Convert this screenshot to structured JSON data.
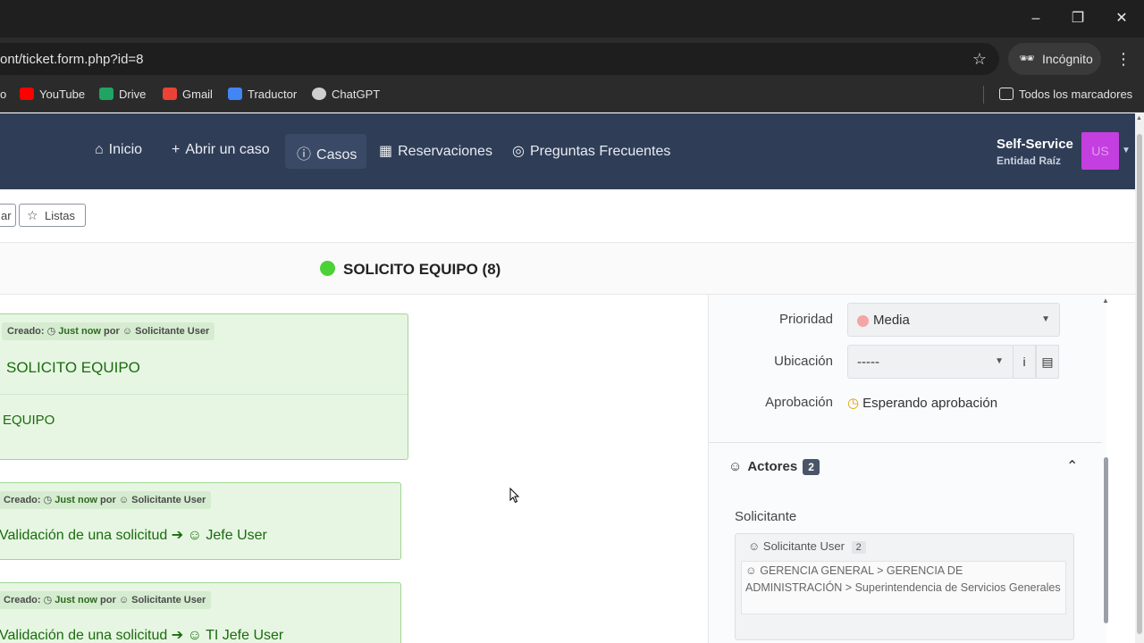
{
  "browser": {
    "url": "ont/ticket.form.php?id=8",
    "incognito_label": "Incógnito",
    "bookmarks": [
      {
        "label": "YouTube",
        "icon": "youtube-icon",
        "color": "#ff0000"
      },
      {
        "label": "Drive",
        "icon": "drive-icon",
        "color": "#1fa463"
      },
      {
        "label": "Gmail",
        "icon": "gmail-icon",
        "color": "#ea4335"
      },
      {
        "label": "Traductor",
        "icon": "translate-icon",
        "color": "#4285f4"
      },
      {
        "label": "ChatGPT",
        "icon": "chatgpt-icon",
        "color": "#cfcfcf"
      }
    ],
    "all_bookmarks_label": "Todos los marcadores"
  },
  "nav": {
    "items": [
      {
        "label": "Inicio",
        "icon": "home-icon"
      },
      {
        "label": "Abrir un caso",
        "icon": "plus-icon"
      },
      {
        "label": "Casos",
        "icon": "alert-circle-icon",
        "active": true
      },
      {
        "label": "Reservaciones",
        "icon": "calendar-icon"
      },
      {
        "label": "Preguntas Frecuentes",
        "icon": "lifebuoy-icon"
      }
    ],
    "profile_name": "Self-Service",
    "profile_entity": "Entidad Raíz",
    "avatar_initials": "US"
  },
  "toolbar": {
    "cut_label": "ar",
    "lists_label": "Listas"
  },
  "ticket": {
    "title": "SOLICITO EQUIPO (8)",
    "status_color": "#4cd137"
  },
  "timeline": [
    {
      "created_label": "Creado:",
      "time": "Just now",
      "by": "por",
      "author": "Solicitante User",
      "title": "SOLICITO EQUIPO",
      "body": "EQUIPO"
    },
    {
      "created_label": "Creado:",
      "time": "Just now",
      "by": "por",
      "author": "Solicitante User",
      "text": "Validación de una solicitud",
      "target": "Jefe User"
    },
    {
      "created_label": "Creado:",
      "time": "Just now",
      "by": "por",
      "author": "Solicitante User",
      "text": "Validación de una solicitud",
      "target": "TI Jefe User"
    }
  ],
  "fields": {
    "priority_label": "Prioridad",
    "priority_value": "Media",
    "location_label": "Ubicación",
    "location_value": "-----",
    "approval_label": "Aprobación",
    "approval_value": "Esperando aprobación"
  },
  "actors": {
    "title": "Actores",
    "count": "2",
    "requester_label": "Solicitante",
    "requester_user": "Solicitante User",
    "requester_user_count": "2",
    "group_path": "GERENCIA GENERAL > GERENCIA DE ADMINISTRACIÓN > Superintendencia de Servicios Generales"
  }
}
